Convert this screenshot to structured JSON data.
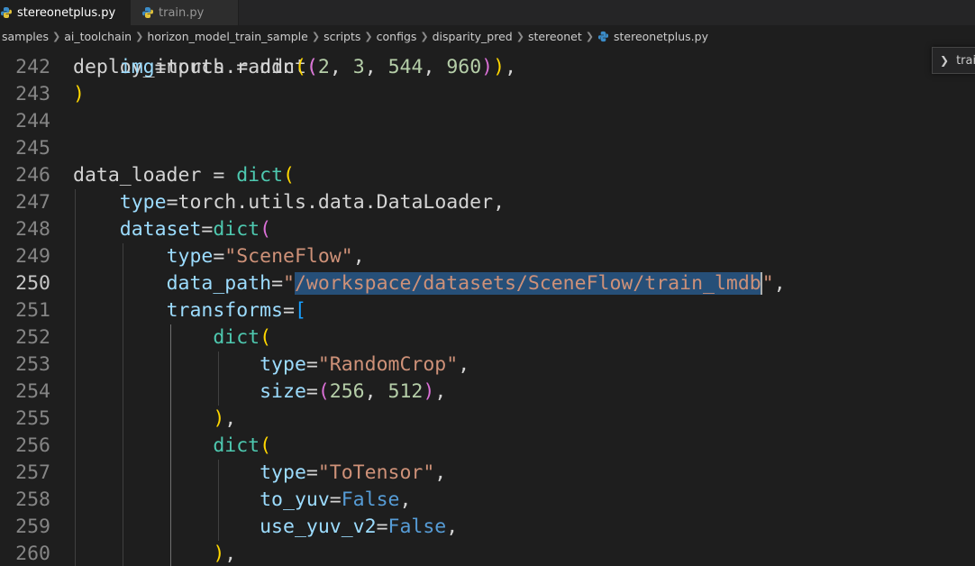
{
  "tabs": [
    {
      "label": "stereonetplus.py",
      "active": true,
      "dirty": true
    },
    {
      "label": "train.py",
      "active": false,
      "dirty": false
    }
  ],
  "breadcrumb": [
    "samples",
    "ai_toolchain",
    "horizon_model_train_sample",
    "scripts",
    "configs",
    "disparity_pred",
    "stereonet",
    "stereonetplus.py"
  ],
  "outline_widget": {
    "label": "trai"
  },
  "colors": {
    "editor_bg": "#1e1e1e",
    "selection": "#264f78",
    "string": "#ce9178",
    "variable": "#9cdcfe",
    "function": "#4ec9b0",
    "number": "#b5cea8",
    "keyword_bool": "#569cd6"
  },
  "editor": {
    "current_line": 250,
    "top_partial_text": "deploy_inputs = dict(",
    "lines": [
      {
        "n": "242",
        "tokens": [
          [
            "    ",
            "plain"
          ],
          [
            "img",
            "var"
          ],
          [
            "=",
            "plain"
          ],
          [
            "torch",
            "plain"
          ],
          [
            ".",
            "plain"
          ],
          [
            "randn",
            "plain"
          ],
          [
            "(",
            "p1"
          ],
          [
            "(",
            "p2"
          ],
          [
            "2",
            "num"
          ],
          [
            ", ",
            "plain"
          ],
          [
            "3",
            "num"
          ],
          [
            ", ",
            "plain"
          ],
          [
            "544",
            "num"
          ],
          [
            ", ",
            "plain"
          ],
          [
            "960",
            "num"
          ],
          [
            ")",
            "p2"
          ],
          [
            ")",
            "p1"
          ],
          [
            ",",
            "plain"
          ]
        ]
      },
      {
        "n": "243",
        "tokens": [
          [
            ")",
            "p1"
          ]
        ]
      },
      {
        "n": "244",
        "tokens": []
      },
      {
        "n": "245",
        "tokens": []
      },
      {
        "n": "246",
        "tokens": [
          [
            "data_loader",
            "plain"
          ],
          [
            " = ",
            "plain"
          ],
          [
            "dict",
            "fn"
          ],
          [
            "(",
            "p1"
          ]
        ]
      },
      {
        "n": "247",
        "tokens": [
          [
            "    ",
            "plain"
          ],
          [
            "type",
            "var"
          ],
          [
            "=",
            "plain"
          ],
          [
            "torch",
            "plain"
          ],
          [
            ".",
            "plain"
          ],
          [
            "utils",
            "plain"
          ],
          [
            ".",
            "plain"
          ],
          [
            "data",
            "plain"
          ],
          [
            ".",
            "plain"
          ],
          [
            "DataLoader",
            "plain"
          ],
          [
            ",",
            "plain"
          ]
        ]
      },
      {
        "n": "248",
        "tokens": [
          [
            "    ",
            "plain"
          ],
          [
            "dataset",
            "var"
          ],
          [
            "=",
            "plain"
          ],
          [
            "dict",
            "fn"
          ],
          [
            "(",
            "p2"
          ]
        ]
      },
      {
        "n": "249",
        "tokens": [
          [
            "        ",
            "plain"
          ],
          [
            "type",
            "var"
          ],
          [
            "=",
            "plain"
          ],
          [
            "\"SceneFlow\"",
            "str"
          ],
          [
            ",",
            "plain"
          ]
        ]
      },
      {
        "n": "250",
        "tokens": [
          [
            "        ",
            "plain"
          ],
          [
            "data_path",
            "var"
          ],
          [
            "=",
            "plain"
          ],
          [
            "\"",
            "str"
          ],
          [
            "/workspace/datasets/SceneFlow/train_lmdb",
            "strsel"
          ],
          [
            "\"",
            "strcur"
          ],
          [
            ",",
            "plain"
          ]
        ]
      },
      {
        "n": "251",
        "tokens": [
          [
            "        ",
            "plain"
          ],
          [
            "transforms",
            "var"
          ],
          [
            "=",
            "plain"
          ],
          [
            "[",
            "p3"
          ]
        ]
      },
      {
        "n": "252",
        "tokens": [
          [
            "            ",
            "plain"
          ],
          [
            "dict",
            "fn"
          ],
          [
            "(",
            "p1"
          ]
        ]
      },
      {
        "n": "253",
        "tokens": [
          [
            "                ",
            "plain"
          ],
          [
            "type",
            "var"
          ],
          [
            "=",
            "plain"
          ],
          [
            "\"RandomCrop\"",
            "str"
          ],
          [
            ",",
            "plain"
          ]
        ]
      },
      {
        "n": "254",
        "tokens": [
          [
            "                ",
            "plain"
          ],
          [
            "size",
            "var"
          ],
          [
            "=",
            "plain"
          ],
          [
            "(",
            "p2"
          ],
          [
            "256",
            "num"
          ],
          [
            ", ",
            "plain"
          ],
          [
            "512",
            "num"
          ],
          [
            ")",
            "p2"
          ],
          [
            ",",
            "plain"
          ]
        ]
      },
      {
        "n": "255",
        "tokens": [
          [
            "            ",
            "plain"
          ],
          [
            ")",
            "p1"
          ],
          [
            ",",
            "plain"
          ]
        ]
      },
      {
        "n": "256",
        "tokens": [
          [
            "            ",
            "plain"
          ],
          [
            "dict",
            "fn"
          ],
          [
            "(",
            "p1"
          ]
        ]
      },
      {
        "n": "257",
        "tokens": [
          [
            "                ",
            "plain"
          ],
          [
            "type",
            "var"
          ],
          [
            "=",
            "plain"
          ],
          [
            "\"ToTensor\"",
            "str"
          ],
          [
            ",",
            "plain"
          ]
        ]
      },
      {
        "n": "258",
        "tokens": [
          [
            "                ",
            "plain"
          ],
          [
            "to_yuv",
            "var"
          ],
          [
            "=",
            "plain"
          ],
          [
            "False",
            "bool"
          ],
          [
            ",",
            "plain"
          ]
        ]
      },
      {
        "n": "259",
        "tokens": [
          [
            "                ",
            "plain"
          ],
          [
            "use_yuv_v2",
            "var"
          ],
          [
            "=",
            "plain"
          ],
          [
            "False",
            "bool"
          ],
          [
            ",",
            "plain"
          ]
        ]
      },
      {
        "n": "260",
        "tokens": [
          [
            "            ",
            "plain"
          ],
          [
            ")",
            "p1"
          ],
          [
            ",",
            "plain"
          ]
        ]
      }
    ]
  }
}
